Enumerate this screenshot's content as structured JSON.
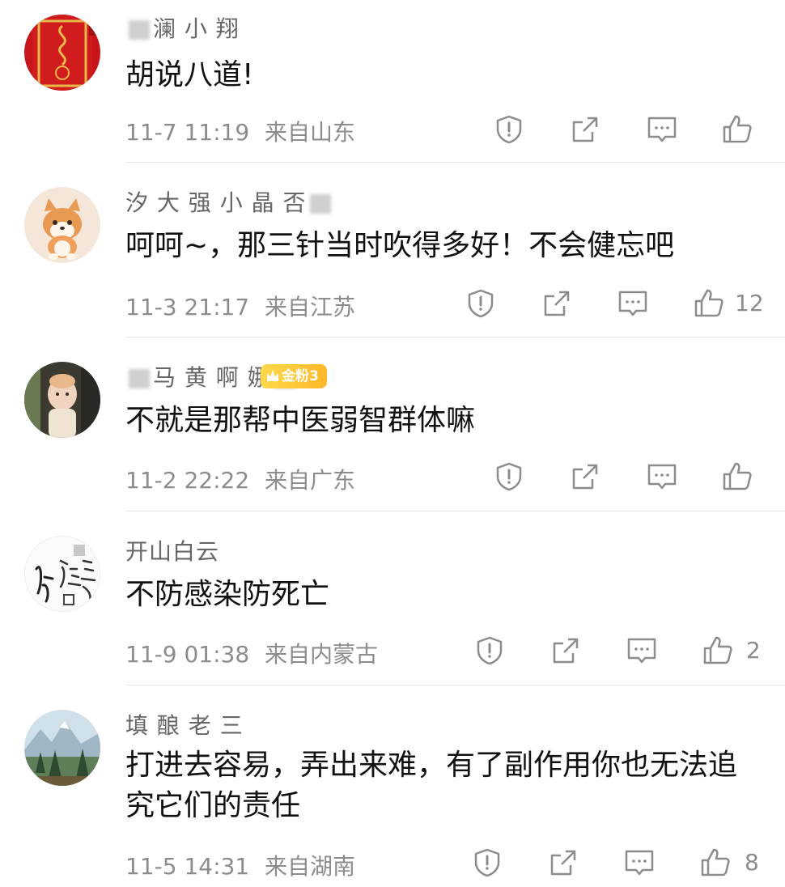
{
  "comments": [
    {
      "username": "澜 小 翔",
      "text": "胡说八道!",
      "time": "11-7 11:19",
      "location": "来自山东",
      "likes": ""
    },
    {
      "username": "汐 大 强 小 晶 否",
      "text": "呵呵~，那三针当时吹得多好！不会健忘吧",
      "time": "11-3 21:17",
      "location": "来自江苏",
      "likes": "12"
    },
    {
      "username": "马 黄 啊 娜",
      "badge": "金粉3",
      "text": "不就是那帮中医弱智群体嘛",
      "time": "11-2 22:22",
      "location": "来自广东",
      "likes": ""
    },
    {
      "username": "开山白云",
      "text": "不防感染防死亡",
      "time": "11-9 01:38",
      "location": "来自内蒙古",
      "likes": "2"
    },
    {
      "username": "填 酿 老 三",
      "text": "打进去容易，弄出来难，有了副作用你也无法追究它们的责任",
      "time": "11-5 14:31",
      "location": "来自湖南",
      "likes": "8"
    }
  ],
  "icons": {
    "report": "report-icon",
    "share": "share-icon",
    "reply": "comment-icon",
    "like": "like-icon"
  },
  "colors": {
    "meta": "#8c8c8c",
    "badge": "#ffb829",
    "divider": "#e6e6e6"
  }
}
